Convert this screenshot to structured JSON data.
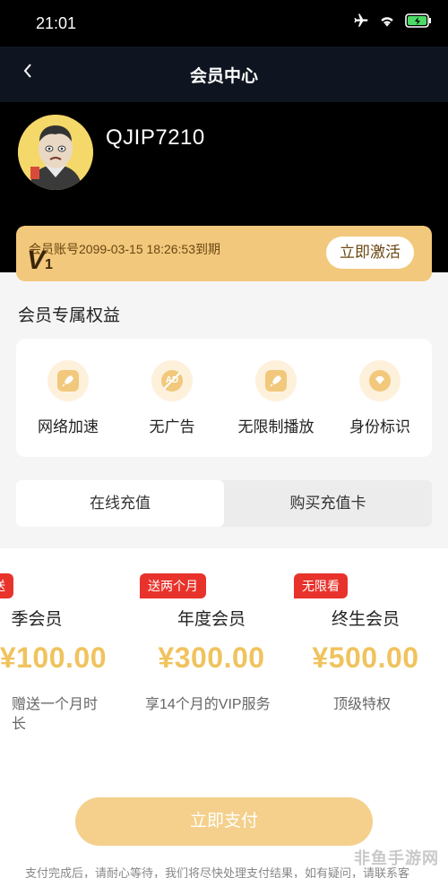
{
  "status_bar": {
    "time": "21:01"
  },
  "nav": {
    "title": "会员中心",
    "back_icon": "chevron-left-icon"
  },
  "profile": {
    "username": "QJIP7210"
  },
  "member_card": {
    "expiry": "会员账号2099-03-15 18:26:53到期",
    "level_letter": "V",
    "level_number": "1",
    "activate_label": "立即激活"
  },
  "benefits_title": "会员专属权益",
  "benefits": [
    {
      "label": "网络加速",
      "icon": "rocket-icon"
    },
    {
      "label": "无广告",
      "icon": "no-ad-icon",
      "icon_text": "AD"
    },
    {
      "label": "无限制播放",
      "icon": "rocket-icon"
    },
    {
      "label": "身份标识",
      "icon": "diamond-icon"
    }
  ],
  "tabs": [
    {
      "label": "在线充值",
      "active": true
    },
    {
      "label": "购买充值卡",
      "active": false
    }
  ],
  "plans": [
    {
      "tag": "送",
      "name": "季会员",
      "price": "¥100.00",
      "desc": "赠送一个月时长"
    },
    {
      "tag": "送两个月",
      "name": "年度会员",
      "price": "¥300.00",
      "desc": "享14个月的VIP服务"
    },
    {
      "tag": "无限看",
      "name": "终生会员",
      "price": "¥500.00",
      "desc": "顶级特权"
    }
  ],
  "pay_button": "立即支付",
  "footer_note": "支付完成后，请耐心等待，我们将尽快处理支付结果，如有疑问，请联系客",
  "watermark": "非鱼手游网",
  "colors": {
    "gold": "#f2c87c",
    "price": "#f0c35e",
    "tag_red": "#e8332c",
    "pay_button": "#f4d08c"
  }
}
